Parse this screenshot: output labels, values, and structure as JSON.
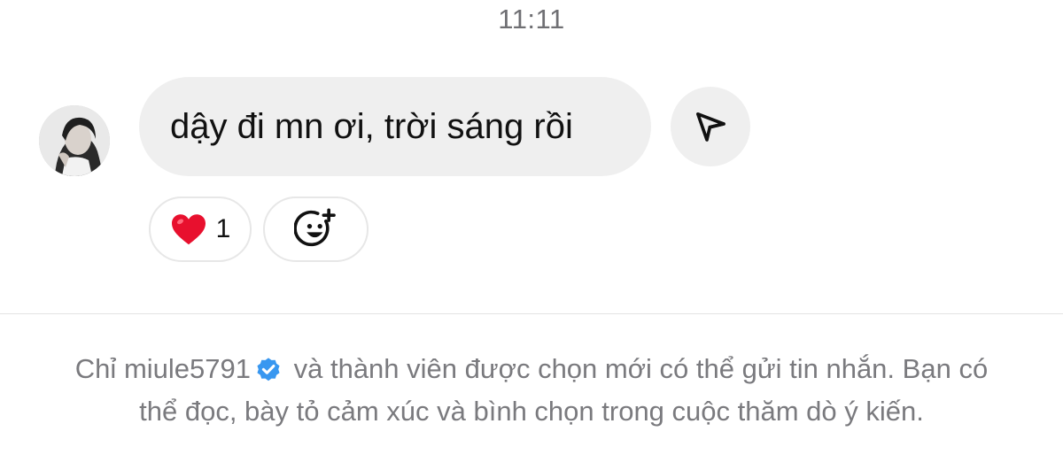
{
  "thread": {
    "timestamp": "11:11"
  },
  "message": {
    "text": "dậy đi mn ơi, trời sáng rồi",
    "avatar_icon": "user-avatar-photo",
    "share_icon": "paper-plane-icon"
  },
  "reactions": {
    "heart": {
      "emoji": "heart-emoji-icon",
      "count": "1"
    },
    "add_reaction_icon": "add-emoji-icon"
  },
  "notice": {
    "prefix": "Chỉ",
    "username": "miule5791",
    "verified_icon": "verified-badge-icon",
    "line1_suffix": "và thành viên được chọn mới có thể gửi tin nhắn.",
    "line2": "Bạn có thể đọc, bày tỏ cảm xúc và bình chọn trong cuộc thăm dò ý kiến."
  },
  "colors": {
    "bubble": "#efefef",
    "muted_text": "#7a7a7e",
    "verified_blue": "#3897f0",
    "heart_red": "#e8102e"
  }
}
